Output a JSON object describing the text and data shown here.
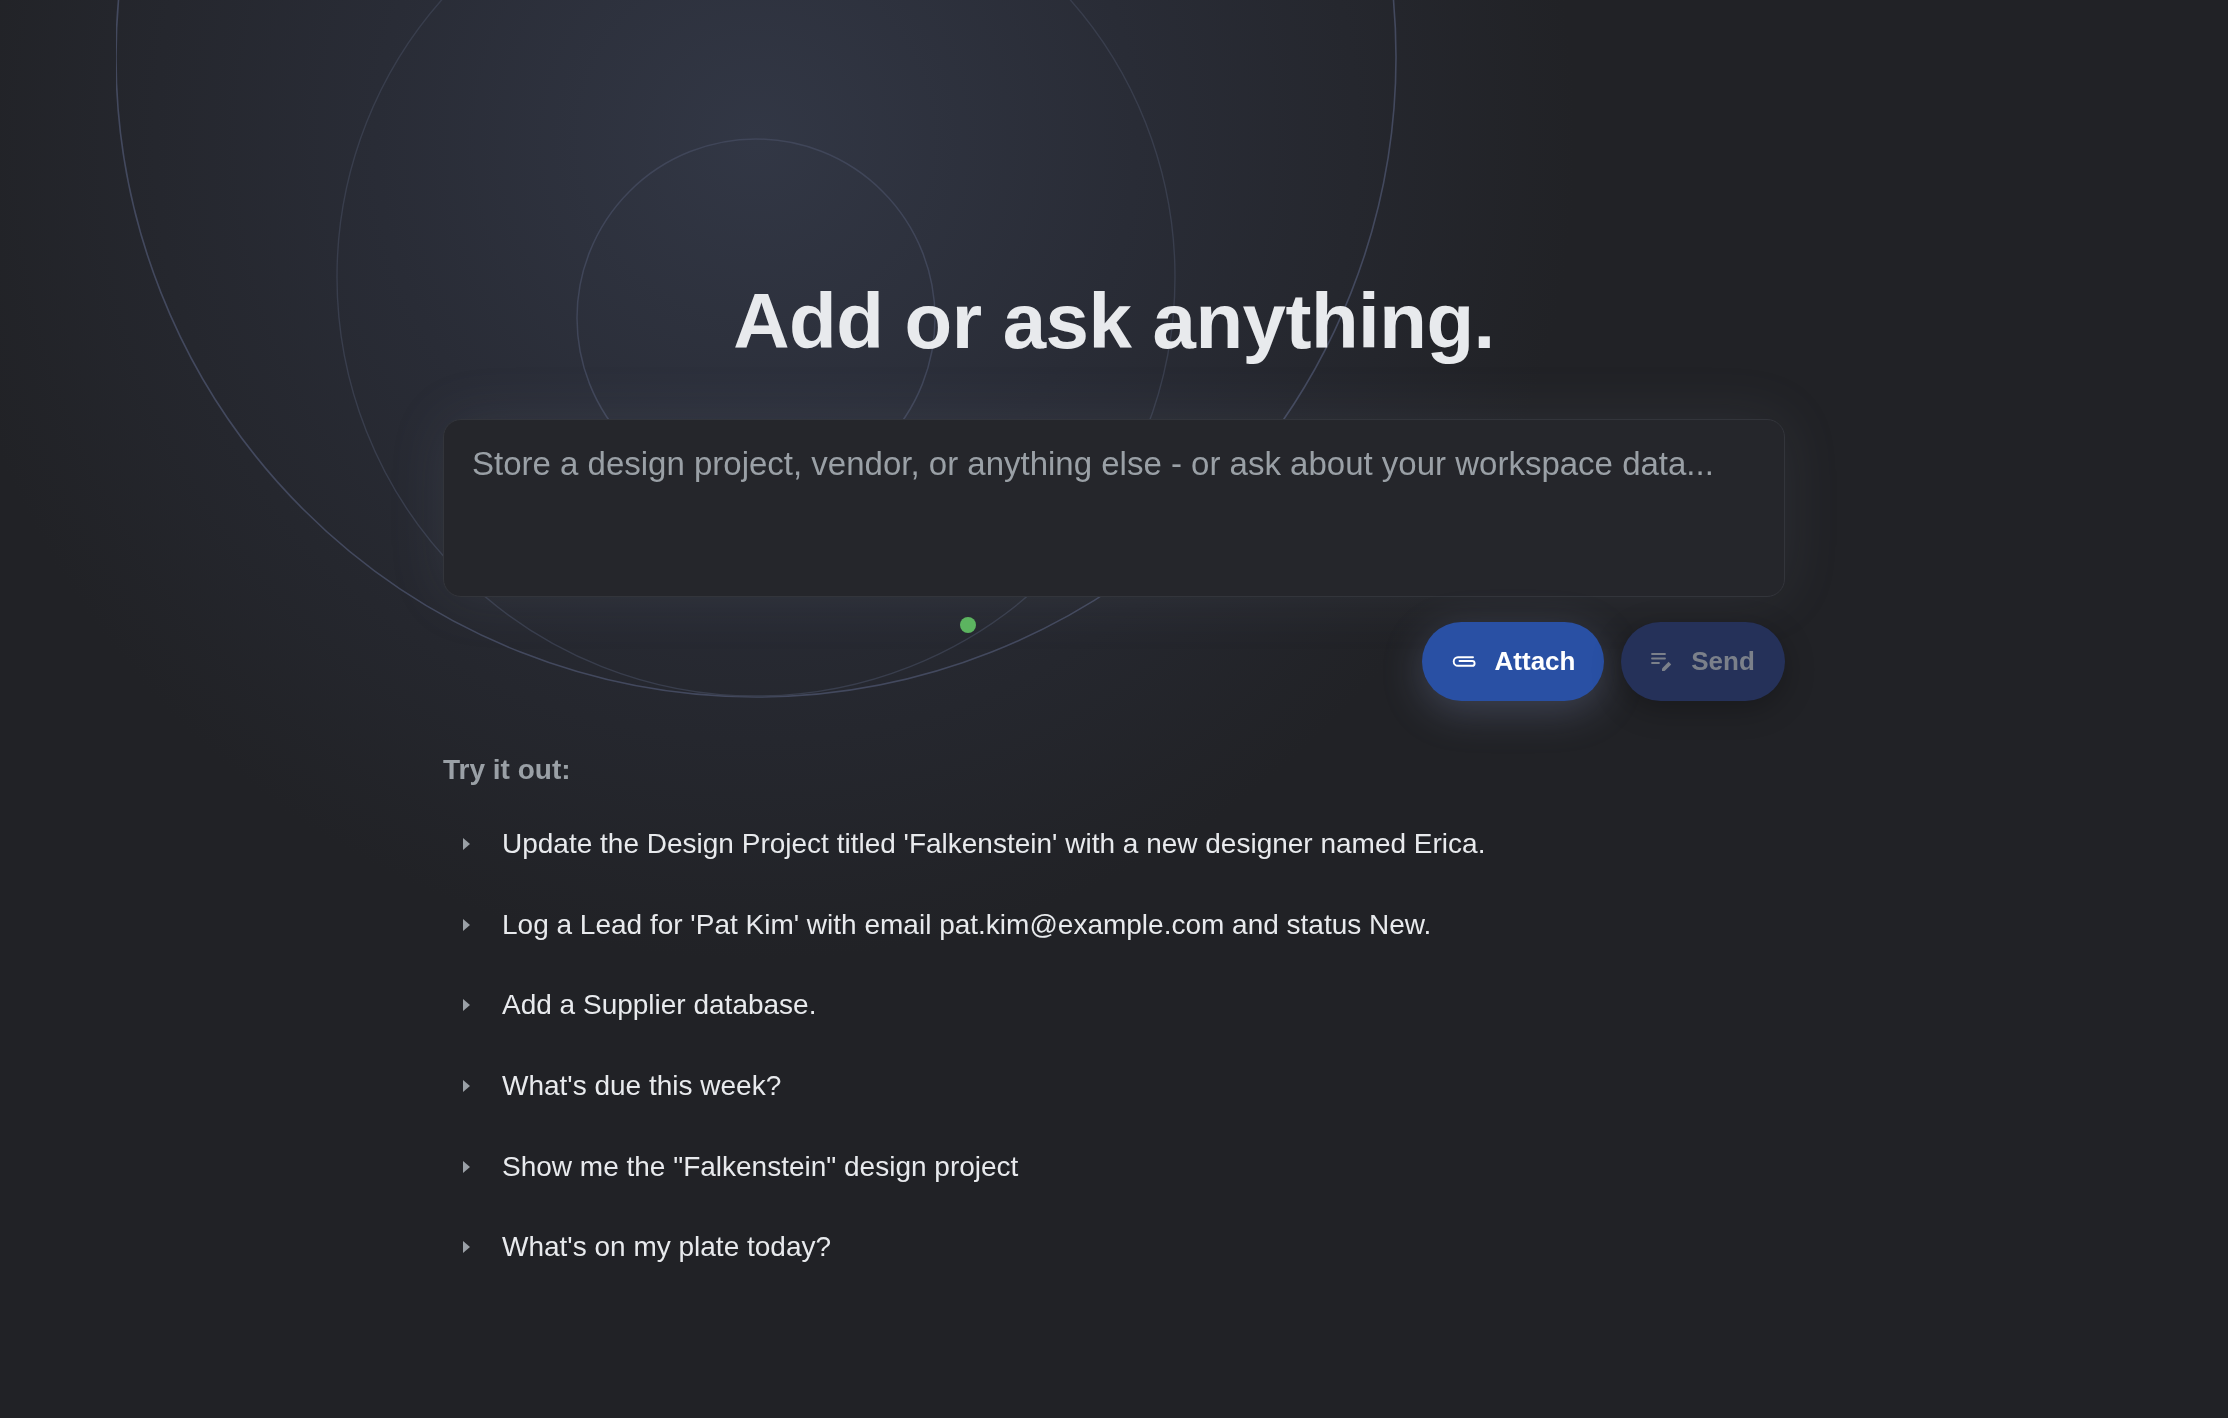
{
  "heading": "Add or ask anything.",
  "prompt": {
    "placeholder": "Store a design project, vendor, or anything else - or ask about your workspace data..."
  },
  "actions": [
    {
      "kind": "attach",
      "label": "Attach",
      "disabled": false
    },
    {
      "kind": "send",
      "label": "Send",
      "disabled": true
    }
  ],
  "suggestions": {
    "title": "Try it out:",
    "items": [
      {
        "text": "Update the Design Project titled 'Falkenstein' with a new designer named Erica.",
        "expanded": false
      },
      {
        "text": "Log a Lead for 'Pat Kim' with email pat.kim@example.com and status New.",
        "expanded": false
      },
      {
        "text": "Add a Supplier database.",
        "expanded": false
      },
      {
        "text": "What's due this week?",
        "expanded": false
      },
      {
        "text": "Show me the \"Falkenstein\" design project",
        "expanded": false
      },
      {
        "text": "What's on my plate today?",
        "expanded": false
      }
    ]
  }
}
